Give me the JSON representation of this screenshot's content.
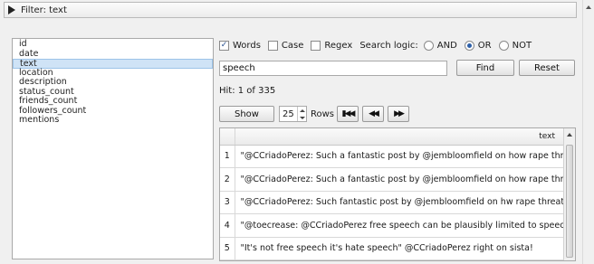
{
  "filter": {
    "label": "Filter: text"
  },
  "fields": [
    {
      "label": "id",
      "selected": false
    },
    {
      "label": "date",
      "selected": false
    },
    {
      "label": "text",
      "selected": true
    },
    {
      "label": "location",
      "selected": false
    },
    {
      "label": "description",
      "selected": false
    },
    {
      "label": "status_count",
      "selected": false
    },
    {
      "label": "friends_count",
      "selected": false
    },
    {
      "label": "followers_count",
      "selected": false
    },
    {
      "label": "mentions",
      "selected": false
    }
  ],
  "options": {
    "words": {
      "label": "Words",
      "checked": true
    },
    "case": {
      "label": "Case",
      "checked": false
    },
    "regex": {
      "label": "Regex",
      "checked": false
    },
    "search_logic_label": "Search logic:",
    "logic": [
      {
        "label": "AND",
        "selected": false
      },
      {
        "label": "OR",
        "selected": true
      },
      {
        "label": "NOT",
        "selected": false
      }
    ]
  },
  "search": {
    "value": "speech",
    "find_label": "Find",
    "reset_label": "Reset"
  },
  "hit": {
    "text": "Hit: 1 of 335"
  },
  "paging": {
    "show_label": "Show",
    "rows_value": "25",
    "rows_label": "Rows"
  },
  "results": {
    "columns": [
      "",
      "text"
    ],
    "rows": [
      {
        "num": "1",
        "text": "\"@CCriadoPerez: Such a fantastic post by @jembloomfield on how rape threa"
      },
      {
        "num": "2",
        "text": "\"@CCriadoPerez: Such a fantastic post by @jembloomfield on how rape threa"
      },
      {
        "num": "3",
        "text": "\"@CCriadoPerez: Such fantastic post by @jembloomfield on hw rape threats a"
      },
      {
        "num": "4",
        "text": "\"@toecrease: @CCriadoPerez free speech can be plausibly limited to speech tl"
      },
      {
        "num": "5",
        "text": "\"It's not free speech it's hate speech\" @CCriadoPerez right on sista!"
      }
    ]
  },
  "icons": {
    "expand": "triangle-right-icon",
    "check": "checkmark-icon",
    "first": "skip-first-icon",
    "prev": "rewind-icon",
    "next": "play-icon"
  }
}
